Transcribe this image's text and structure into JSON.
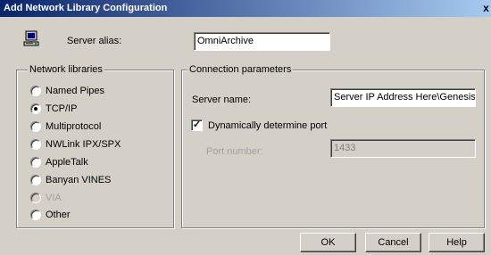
{
  "window": {
    "title": "Add Network Library Configuration",
    "close_glyph": "x"
  },
  "alias": {
    "label": "Server alias:",
    "value": "OmniArchive",
    "icon": "computer-icon"
  },
  "network_libraries": {
    "legend": "Network libraries",
    "options": [
      {
        "label": "Named Pipes",
        "checked": false,
        "enabled": true
      },
      {
        "label": "TCP/IP",
        "checked": true,
        "enabled": true
      },
      {
        "label": "Multiprotocol",
        "checked": false,
        "enabled": true
      },
      {
        "label": "NWLink IPX/SPX",
        "checked": false,
        "enabled": true
      },
      {
        "label": "AppleTalk",
        "checked": false,
        "enabled": true
      },
      {
        "label": "Banyan VINES",
        "checked": false,
        "enabled": true
      },
      {
        "label": "VIA",
        "checked": false,
        "enabled": false
      },
      {
        "label": "Other",
        "checked": false,
        "enabled": true
      }
    ]
  },
  "connection_parameters": {
    "legend": "Connection parameters",
    "server_name_label": "Server name:",
    "server_name_value": "Server IP Address Here\\Genesis",
    "dynamic_port_label": "Dynamically determine port",
    "dynamic_port_checked": true,
    "port_label": "Port number:",
    "port_value": "1433"
  },
  "buttons": {
    "ok": "OK",
    "cancel": "Cancel",
    "help": "Help"
  }
}
